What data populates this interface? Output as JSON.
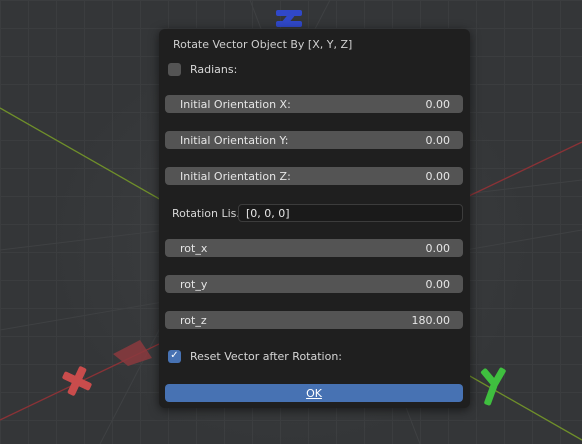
{
  "dialog": {
    "title": "Rotate Vector Object By [X, Y, Z]",
    "radians": {
      "label": "Radians:",
      "checked": false
    },
    "fields": [
      {
        "label": "Initial Orientation X:",
        "value": "0.00"
      },
      {
        "label": "Initial Orientation Y:",
        "value": "0.00"
      },
      {
        "label": "Initial Orientation Z:",
        "value": "0.00"
      }
    ],
    "rotation_list": {
      "label": "Rotation Lis...",
      "value": "[0, 0, 0]"
    },
    "rot_fields": [
      {
        "label": "rot_x",
        "value": "0.00"
      },
      {
        "label": "rot_y",
        "value": "0.00"
      },
      {
        "label": "rot_z",
        "value": "180.00"
      }
    ],
    "reset": {
      "label": "Reset Vector after Rotation:",
      "checked": true
    },
    "ok_label": "OK"
  },
  "scene": {
    "x_axis_color": "#8a3236",
    "y_axis_color": "#6f8f2a",
    "x_gizmo_color": "#c94c4c",
    "y_gizmo_color": "#3fbf3f",
    "z_gizmo_color": "#3048c8",
    "x_label": "X",
    "y_label": "Y"
  }
}
